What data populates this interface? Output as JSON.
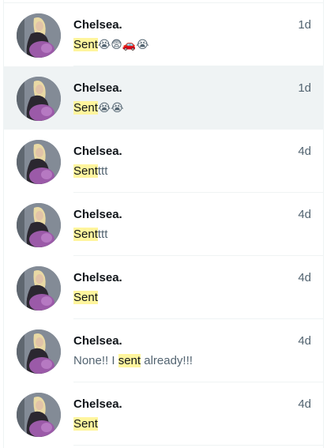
{
  "conversations": [
    {
      "name": "Chelsea.",
      "time": "1d",
      "highlight": "Sent",
      "rest": "😭😨🚗😭",
      "active": false
    },
    {
      "name": "Chelsea.",
      "time": "1d",
      "highlight": "Sent",
      "rest": "😭😭",
      "active": true
    },
    {
      "name": "Chelsea.",
      "time": "4d",
      "highlight": "Sent",
      "rest": "ttt",
      "active": false
    },
    {
      "name": "Chelsea.",
      "time": "4d",
      "highlight": "Sent",
      "rest": "ttt",
      "active": false
    },
    {
      "name": "Chelsea.",
      "time": "4d",
      "highlight": "Sent",
      "rest": "",
      "active": false
    },
    {
      "name": "Chelsea.",
      "time": "4d",
      "pre": "None!! I ",
      "highlight": "sent",
      "rest": " already!!!",
      "active": false
    },
    {
      "name": "Chelsea.",
      "time": "4d",
      "highlight": "Sent",
      "rest": "",
      "active": false
    }
  ],
  "colors": {
    "highlight": "#fff59d",
    "active_row": "#eff3f4",
    "secondary_text": "#536471"
  },
  "avatar_icon": "profile-photo"
}
